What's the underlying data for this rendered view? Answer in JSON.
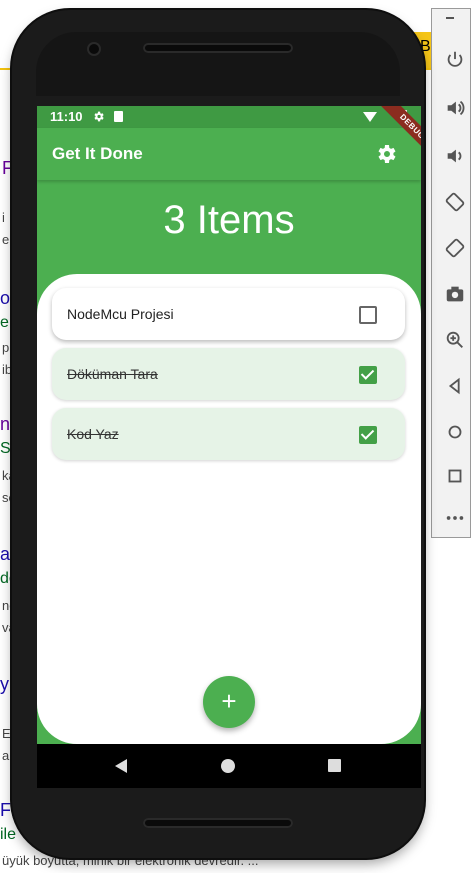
{
  "background": {
    "yellow_text": "B",
    "fragments": [
      {
        "text": "F",
        "color": "#660099"
      },
      {
        "text": "i",
        "color": "#444444"
      },
      {
        "text": "e",
        "color": "#444444"
      },
      {
        "text": "og",
        "color": "#1a0dab"
      },
      {
        "text": "e",
        "color": "#006621"
      },
      {
        "text": "p",
        "color": "#444444"
      },
      {
        "text": "ib",
        "color": "#444444"
      },
      {
        "text": "n",
        "color": "#660099"
      },
      {
        "text": "S-i",
        "color": "#006621"
      },
      {
        "text": "ka",
        "color": "#444444"
      },
      {
        "text": "se",
        "color": "#444444"
      },
      {
        "text": "a",
        "color": "#1a0dab"
      },
      {
        "text": "de",
        "color": "#006621"
      },
      {
        "text": "no",
        "color": "#444444"
      },
      {
        "text": "va",
        "color": "#444444"
      },
      {
        "text": "y",
        "color": "#1a0dab"
      },
      {
        "text": "E",
        "color": "#444444"
      },
      {
        "text": "ar",
        "color": "#444444"
      },
      {
        "text": "Fi",
        "color": "#1a0dab"
      },
      {
        "text": "ile",
        "color": "#006621"
      }
    ],
    "bottom_snippet": "üyük boyutta, minik bir elektronik devredir. ..."
  },
  "statusbar": {
    "time": "11:10"
  },
  "debug_banner": "DEBUG",
  "appbar": {
    "title": "Get It Done",
    "settings_icon": "gear-icon"
  },
  "summary": {
    "count_text": "3 Items"
  },
  "todos": [
    {
      "label": "NodeMcu Projesi",
      "checked": false
    },
    {
      "label": "Döküman Tara",
      "checked": true
    },
    {
      "label": "Kod Yaz",
      "checked": true
    }
  ],
  "fab": {
    "icon": "plus-icon",
    "symbol": "+"
  },
  "colors": {
    "primary": "#4caf50",
    "status": "#3f9a43",
    "done_item": "#e6f3e7",
    "checkbox_on": "#43a047"
  }
}
